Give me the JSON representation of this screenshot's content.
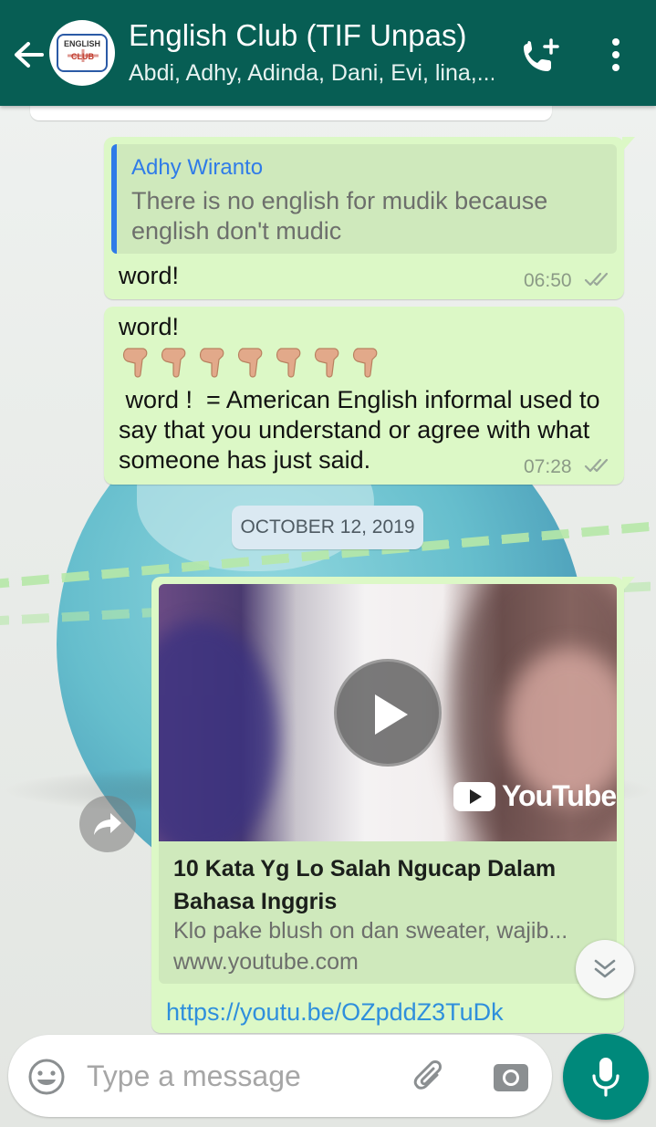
{
  "header": {
    "title": "English Club (TIF Unpas)",
    "members": "Abdi, Adhy, Adinda, Dani, Evi, lina,...",
    "avatar_text_top": "ENGLISH",
    "avatar_text_bottom": "CLUB",
    "icons": [
      "back-arrow-icon",
      "add-call-icon",
      "more-vert-icon"
    ]
  },
  "messages": [
    {
      "quote": {
        "author": "Adhy Wiranto",
        "text": "There is no english for mudik because english don't mudic"
      },
      "text": "word!",
      "time": "06:50",
      "status": "read"
    },
    {
      "line1": "word!",
      "emoji_count": 7,
      "emoji": "backhand-index-pointing-down",
      "text": " word !  = American English informal used to say that you understand or agree with what someone has just said.",
      "time": "07:28",
      "status": "read"
    }
  ],
  "date_chip": "OCTOBER 12, 2019",
  "link_message": {
    "video_provider": "YouTube",
    "title": "10 Kata Yg Lo Salah Ngucap Dalam Bahasa Inggris",
    "description": "Klo pake blush on dan sweater, wajib...",
    "domain": "www.youtube.com",
    "url": "https://youtu.be/OZpddZ3TuDk"
  },
  "composer": {
    "placeholder": "Type a message"
  },
  "colors": {
    "header": "#075e54",
    "bubble_out": "#dcf8c6",
    "accent": "#00897b",
    "link": "#2f8fdc",
    "quote_author": "#2f7be8"
  }
}
